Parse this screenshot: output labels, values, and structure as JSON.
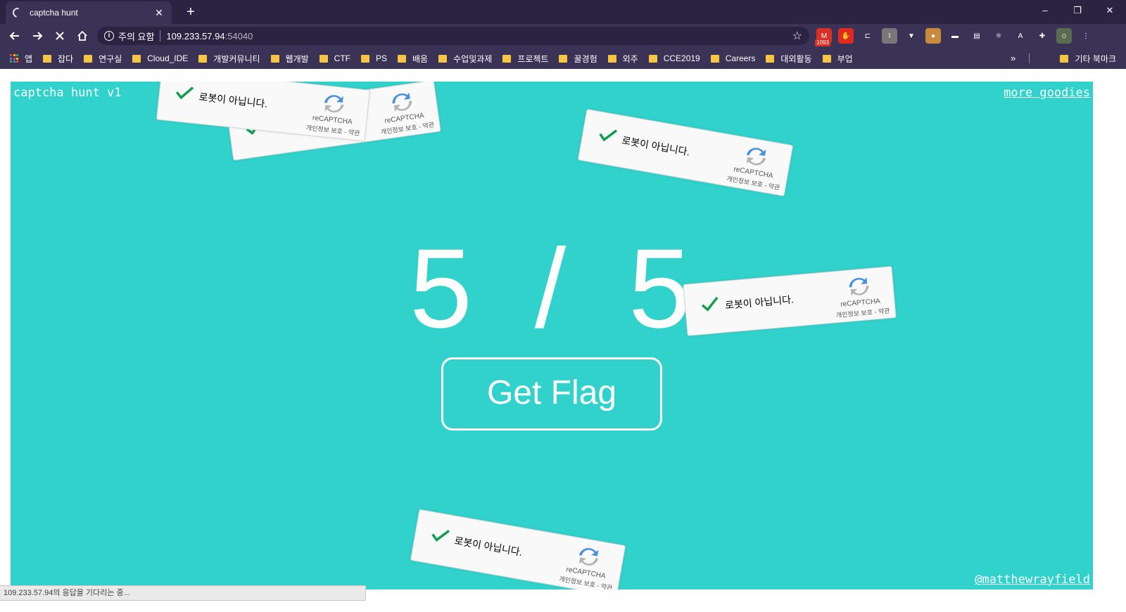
{
  "browser": {
    "tab": {
      "title": "captcha hunt"
    },
    "new_tab_label": "+",
    "window_controls": [
      "–",
      "❐",
      "✕"
    ],
    "address": {
      "security_label": "주의 요함",
      "host": "109.233.57.94",
      "port": ":54040"
    },
    "extensions": [
      {
        "name": "gmail-icon",
        "badge": "1093",
        "color": "#d93025"
      },
      {
        "name": "adblock-icon",
        "color": "#e0291f"
      },
      {
        "name": "clipper-icon",
        "color": "#3a3355"
      },
      {
        "name": "info-ext-icon",
        "color": "#777777"
      },
      {
        "name": "vue-devtools-icon",
        "color": "#3a3355"
      },
      {
        "name": "cookie-icon",
        "color": "#c98a3e"
      },
      {
        "name": "screen-icon",
        "color": "#3a3355"
      },
      {
        "name": "print-icon",
        "color": "#3a3355"
      },
      {
        "name": "react-devtools-icon",
        "color": "#3a3355"
      },
      {
        "name": "pdf-icon",
        "color": "#3a3355"
      },
      {
        "name": "extensions-puzzle-icon",
        "color": "#3a3355"
      },
      {
        "name": "profile-avatar-icon",
        "color": "#5b6b4f"
      },
      {
        "name": "menu-kebab-icon",
        "color": "#3a3355"
      }
    ],
    "bookmarks": {
      "apps_label": "앱",
      "items": [
        "잡다",
        "연구실",
        "Cloud_IDE",
        "개발커뮤니티",
        "웹개발",
        "CTF",
        "PS",
        "배움",
        "수업및과제",
        "프로젝트",
        "꿀경험",
        "외주",
        "CCE2019",
        "Careers",
        "대외활동",
        "부업"
      ],
      "more_label": "»",
      "other_label": "기타 북마크"
    },
    "status_text": "109.233.57.94의 응답을 기다리는 중..."
  },
  "page": {
    "brand": "captcha hunt v1",
    "goodies_link": "more goodies",
    "credit_link": "@matthewrayfield",
    "score": {
      "solved": "5",
      "separator": "/",
      "total": "5"
    },
    "get_flag_label": "Get Flag",
    "colors": {
      "background": "#31d2cc",
      "check": "#119e4f"
    }
  },
  "captcha": {
    "label": "로봇이 아닙니다.",
    "brand": "reCAPTCHA",
    "terms": "개인정보 보호 - 약관"
  }
}
